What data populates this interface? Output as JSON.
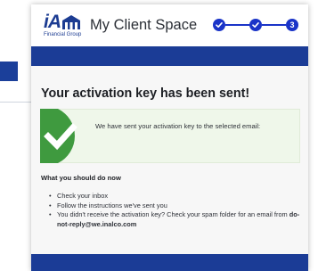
{
  "header": {
    "logo_main": "iA",
    "logo_sub": "Financial Group",
    "title": "My Client Space"
  },
  "stepper": {
    "steps": [
      {
        "state": "done",
        "icon": "check-icon"
      },
      {
        "state": "done",
        "icon": "check-icon"
      },
      {
        "state": "current",
        "label": "3"
      }
    ],
    "color": "#1a34c8"
  },
  "main": {
    "heading": "Your activation key has been sent!",
    "notice": {
      "text": "We have sent your activation key to the selected email:",
      "icon": "checkmark-icon",
      "accent_color": "#3f9a3f"
    },
    "next_steps": {
      "title": "What you should do now",
      "items": [
        {
          "text": "Check your inbox"
        },
        {
          "text": "Follow the instructions we've sent you"
        },
        {
          "text": "You didn't receive the activation key? Check your spam folder for an email from ",
          "email": "do-not-reply@we.inalco.com"
        }
      ]
    }
  },
  "colors": {
    "brand_blue": "#1b3c96",
    "content_bg": "#f7f7f7",
    "notice_bg": "#eff7ea"
  }
}
